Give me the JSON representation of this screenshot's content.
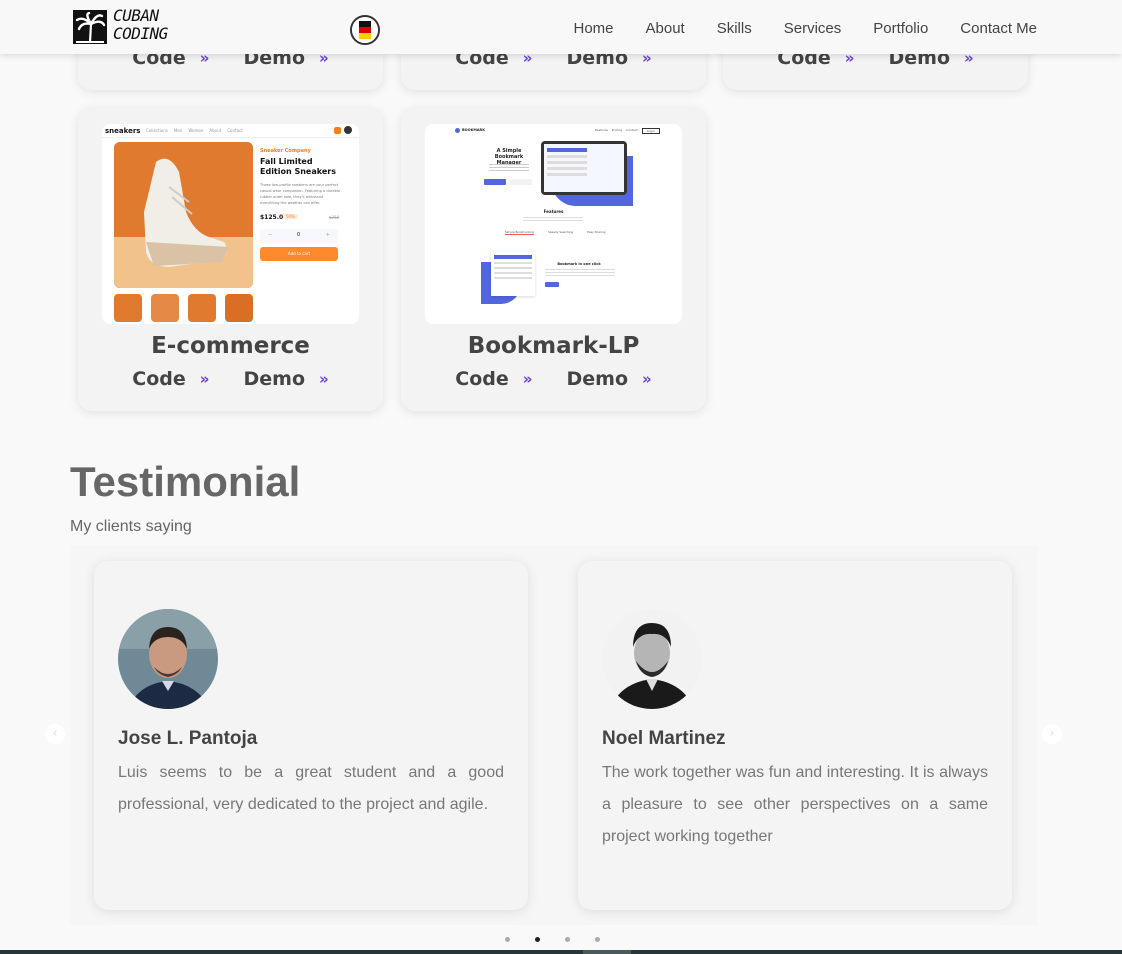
{
  "header": {
    "logo_line1": "CUBAN",
    "logo_line2": "CODING",
    "nav": [
      "Home",
      "About",
      "Skills",
      "Services",
      "Portfolio",
      "Contact Me"
    ]
  },
  "portfolio": {
    "top_row": [
      {
        "code_label": "Code",
        "demo_label": "Demo"
      },
      {
        "code_label": "Code",
        "demo_label": "Demo"
      },
      {
        "code_label": "Code",
        "demo_label": "Demo"
      }
    ],
    "projects": [
      {
        "title": "E-commerce",
        "code_label": "Code",
        "demo_label": "Demo",
        "preview": {
          "brand": "sneakers",
          "nav": [
            "Collections",
            "Men",
            "Women",
            "About",
            "Contact"
          ],
          "company": "Sneaker Company",
          "product": "Fall Limited Edition Sneakers",
          "description": "These low-profile sneakers are your perfect casual wear companion. Featuring a durable rubber outer sole, they'll withstand everything the weather can offer.",
          "price": "$125.00",
          "discount": "50%",
          "old_price": "$250",
          "qty": "0",
          "cart": "Add to cart"
        }
      },
      {
        "title": "Bookmark-LP",
        "code_label": "Code",
        "demo_label": "Demo",
        "preview": {
          "brand": "BOOKMARK",
          "nav": [
            "Features",
            "Pricing",
            "Contact",
            "Login"
          ],
          "hero_title": "A Simple Bookmark Manager",
          "features_title": "Features",
          "tabs": [
            "Simple Bookmarking",
            "Speedy Searching",
            "Easy Sharing"
          ],
          "feature_heading": "Bookmark in one click"
        }
      }
    ]
  },
  "testimonial": {
    "title": "Testimonial",
    "subtitle": "My clients saying",
    "items": [
      {
        "name": "Jose L. Pantoja",
        "text": "Luis seems to be a great student and a good professional, very dedicated to the project and agile."
      },
      {
        "name": "Noel Martinez",
        "text": "The work together was fun and interesting. It is always a pleasure to see other perspectives on a same project working together"
      }
    ],
    "prev_icon": "chevron-left-icon",
    "next_icon": "chevron-right-icon",
    "dots_count": 4,
    "active_dot": 2
  },
  "colors": {
    "accent": "#6a3fd8",
    "orange": "#ff7d1a",
    "bookmark_blue": "#5267df"
  }
}
